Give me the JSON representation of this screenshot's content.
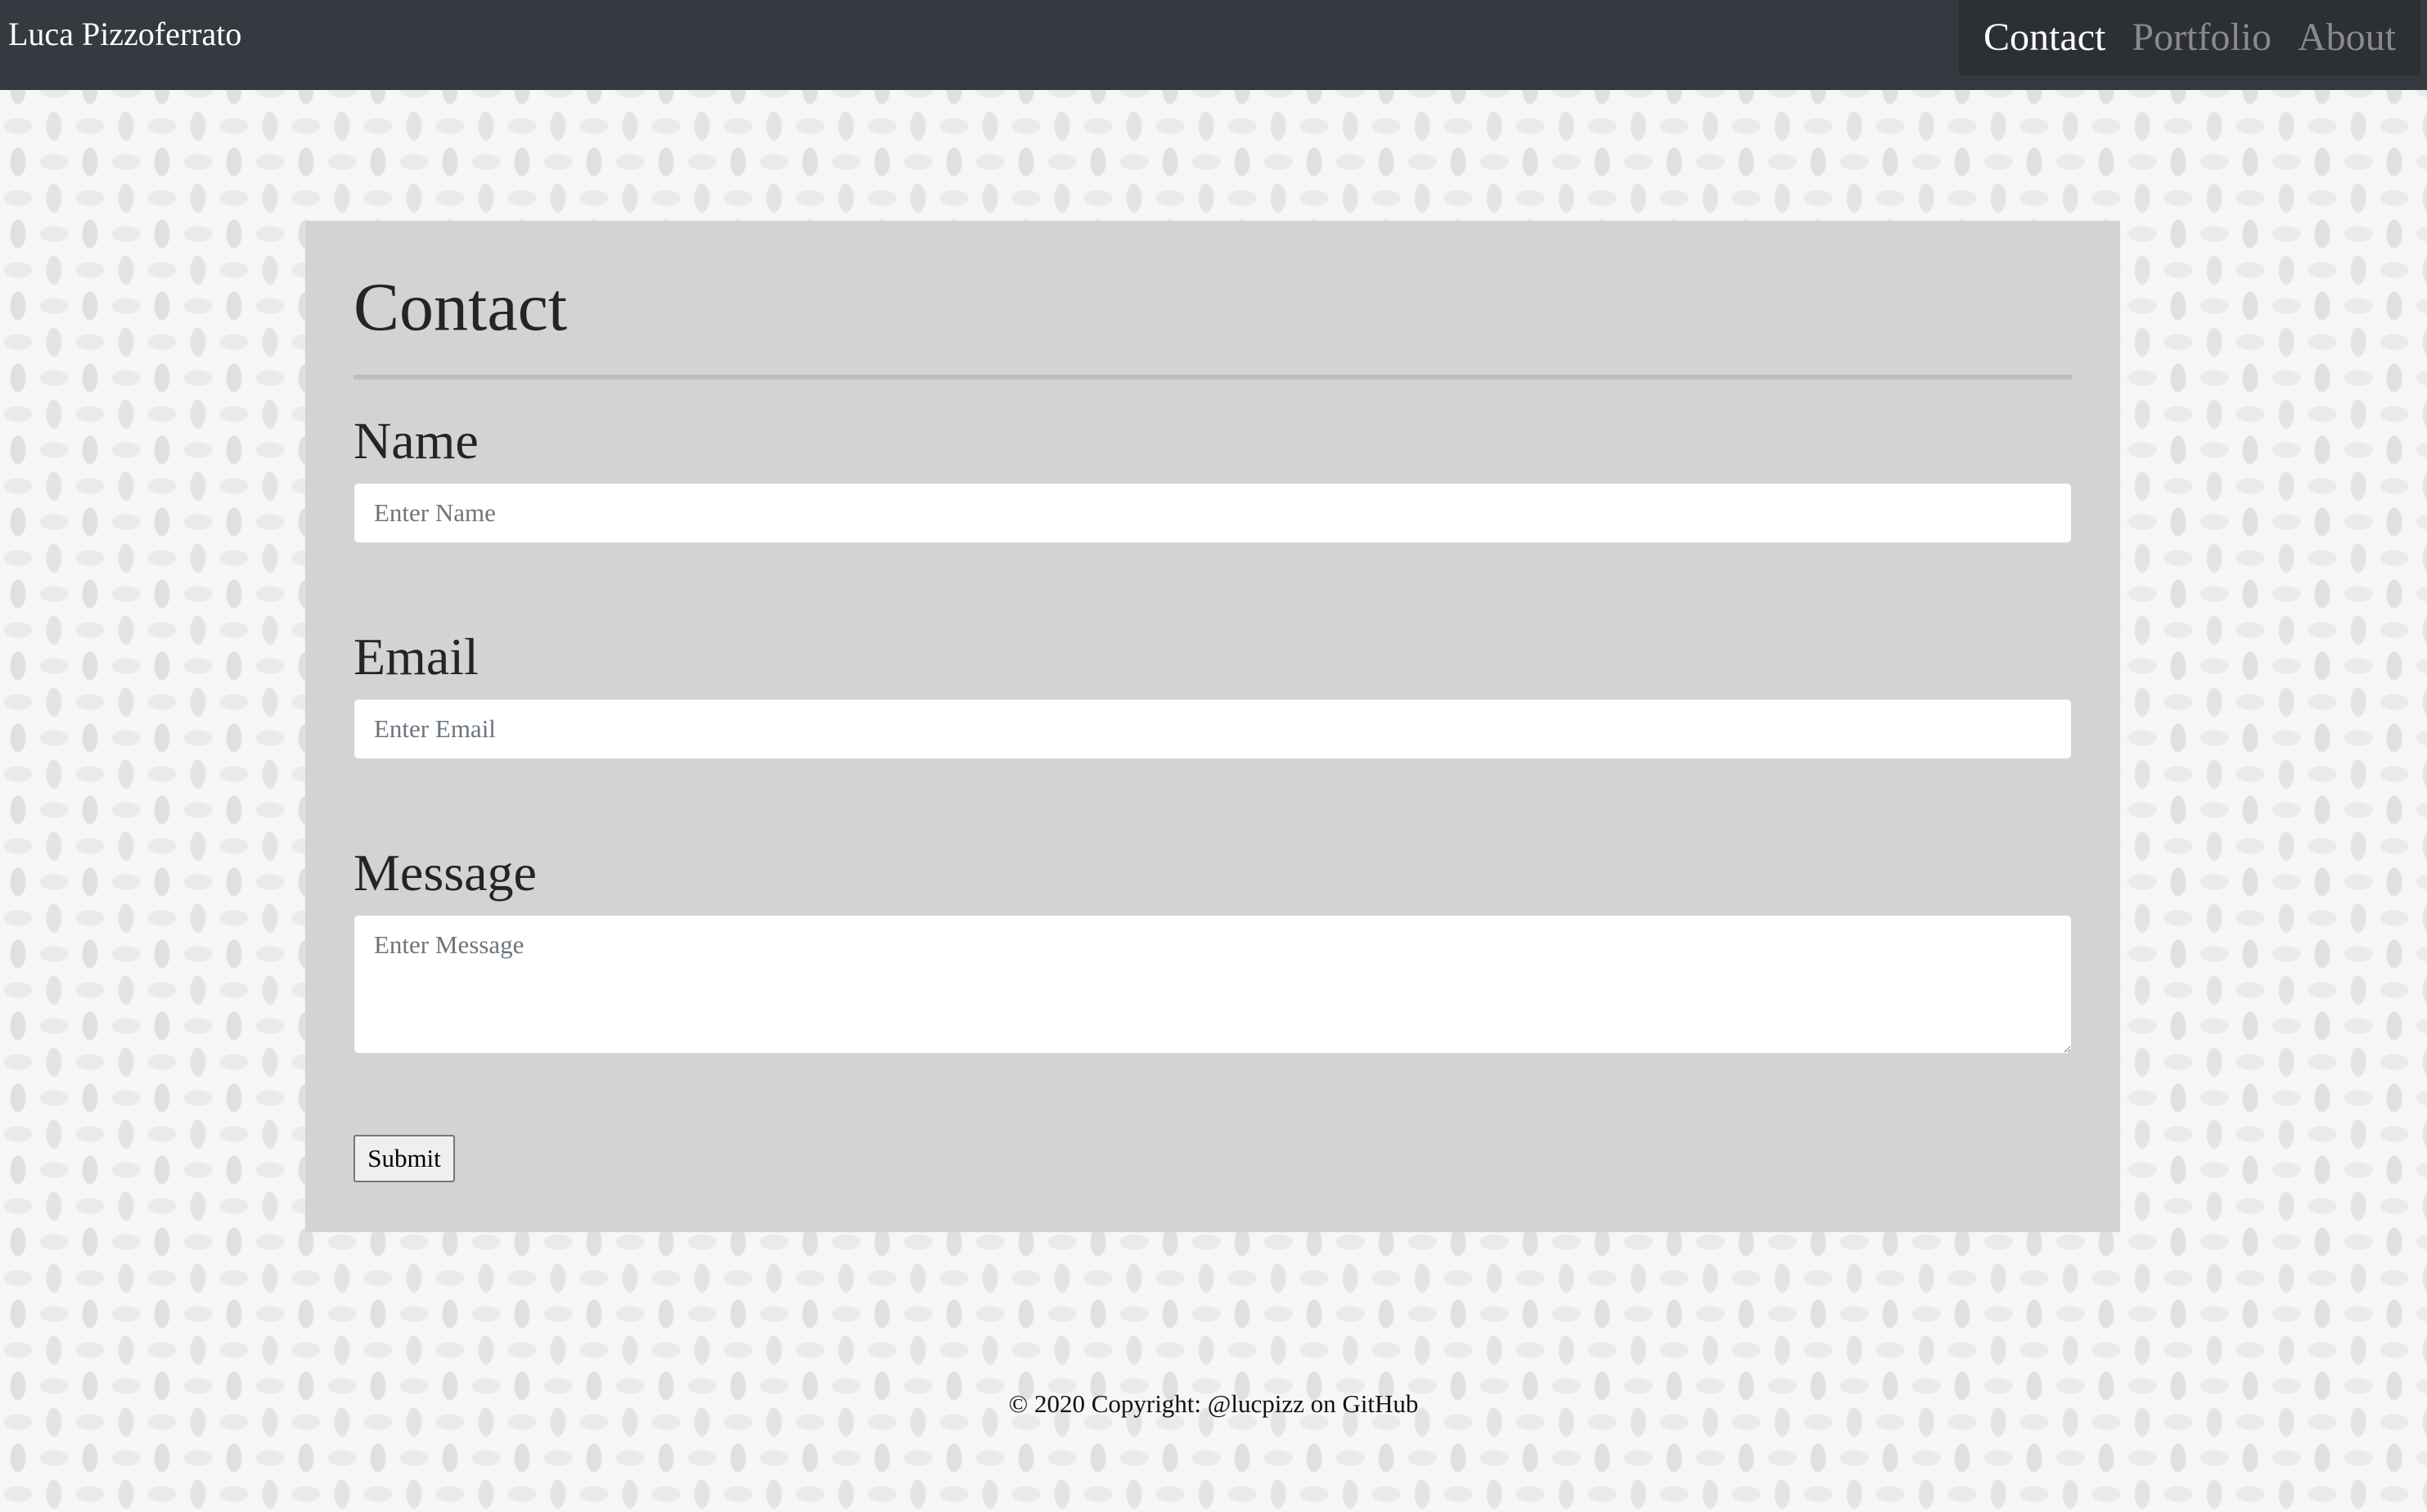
{
  "navbar": {
    "brand": "Luca Pizzoferrato",
    "links": [
      {
        "label": "Contact",
        "active": true
      },
      {
        "label": "Portfolio",
        "active": false
      },
      {
        "label": "About",
        "active": false
      }
    ]
  },
  "contact_card": {
    "title": "Contact",
    "fields": {
      "name": {
        "label": "Name",
        "placeholder": "Enter Name",
        "value": ""
      },
      "email": {
        "label": "Email",
        "placeholder": "Enter Email",
        "value": ""
      },
      "message": {
        "label": "Message",
        "placeholder": "Enter Message",
        "value": ""
      }
    },
    "submit_label": "Submit"
  },
  "footer": {
    "text": "© 2020 Copyright: @lucpizz on GitHub"
  },
  "colors": {
    "navbar_bg": "#343a40",
    "card_bg": "#d3d3d3",
    "text_dark": "#212529",
    "nav_inactive": "#8a8a8a"
  }
}
